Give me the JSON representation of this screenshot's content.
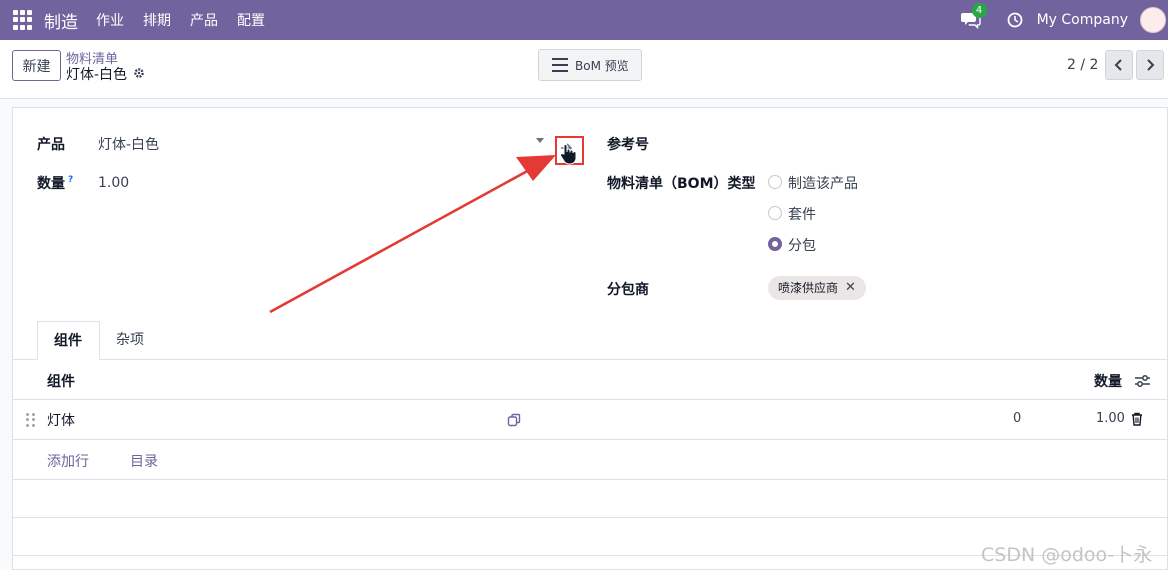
{
  "navbar": {
    "app_name": "制造",
    "menus": [
      "作业",
      "排期",
      "产品",
      "配置"
    ],
    "chat_badge": "4",
    "company": "My Company"
  },
  "control_panel": {
    "new_label": "新建",
    "breadcrumb_parent": "物料清单",
    "breadcrumb_current": "灯体-白色",
    "bom_button_label": "BoM 预览",
    "pager": "2 / 2"
  },
  "form": {
    "product_label": "产品",
    "product_value": "灯体-白色",
    "quantity_label": "数量",
    "quantity_tooltip": "?",
    "quantity_value": "1.00",
    "reference_label": "参考号",
    "bom_type_label": "物料清单（BOM）类型",
    "bom_type_options": [
      "制造该产品",
      "套件",
      "分包"
    ],
    "bom_type_selected": "分包",
    "subcontractor_label": "分包商",
    "subcontractor_tag": "喷漆供应商",
    "subcontractor_tag_close": "✕"
  },
  "tabs": {
    "components": "组件",
    "misc": "杂项"
  },
  "table": {
    "col_component": "组件",
    "col_quantity": "数量",
    "rows": [
      {
        "name": "灯体",
        "available": "0",
        "quantity": "1.00"
      }
    ],
    "add_line": "添加行",
    "catalog": "目录"
  },
  "watermark": "CSDN @odoo-卜永",
  "colors": {
    "brand": "#71639e",
    "annotation": "#e53935"
  }
}
